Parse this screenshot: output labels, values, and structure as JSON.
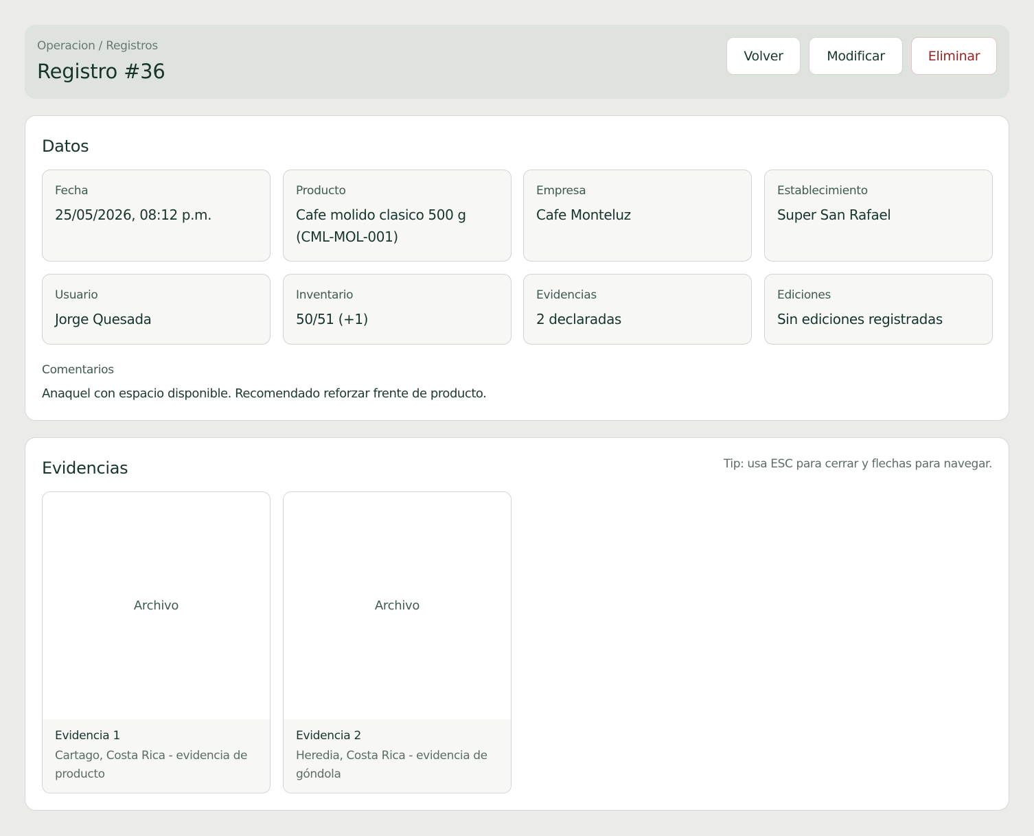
{
  "header": {
    "breadcrumb": "Operacion / Registros",
    "title": "Registro #36",
    "buttons": {
      "back": "Volver",
      "edit": "Modificar",
      "delete": "Eliminar"
    }
  },
  "datos": {
    "title": "Datos",
    "fields": [
      {
        "label": "Fecha",
        "value": "25/05/2026, 08:12 p.m."
      },
      {
        "label": "Producto",
        "value": "Cafe molido clasico 500 g (CML-MOL-001)"
      },
      {
        "label": "Empresa",
        "value": "Cafe Monteluz"
      },
      {
        "label": "Establecimiento",
        "value": "Super San Rafael"
      },
      {
        "label": "Usuario",
        "value": "Jorge Quesada"
      },
      {
        "label": "Inventario",
        "value": "50/51 (+1)"
      },
      {
        "label": "Evidencias",
        "value": "2 declaradas"
      },
      {
        "label": "Ediciones",
        "value": "Sin ediciones registradas"
      }
    ],
    "comments_label": "Comentarios",
    "comments_text": "Anaquel con espacio disponible. Recomendado reforzar frente de producto."
  },
  "evidencias": {
    "title": "Evidencias",
    "tip": "Tip: usa ESC para cerrar y flechas para navegar.",
    "items": [
      {
        "thumb_label": "Archivo",
        "title": "Evidencia 1",
        "description": "Cartago, Costa Rica - evidencia de producto"
      },
      {
        "thumb_label": "Archivo",
        "title": "Evidencia 2",
        "description": "Heredia, Costa Rica - evidencia de góndola"
      }
    ]
  },
  "colors": {
    "background": "#ebece9",
    "header_bg": "#dfe3de",
    "text_primary": "#16352b",
    "danger": "#9b1f1f"
  }
}
